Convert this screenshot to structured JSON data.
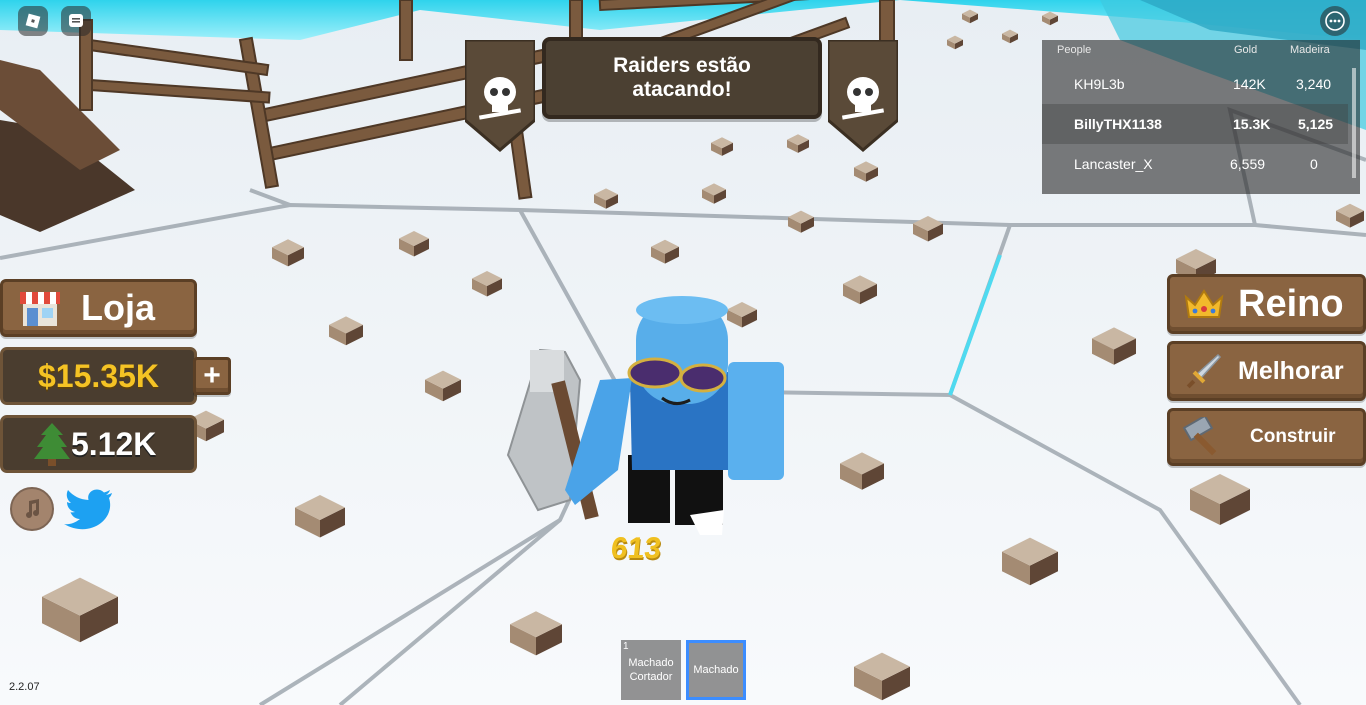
{
  "banner": {
    "line1": "Raiders estão",
    "line2": "atacando!"
  },
  "leaderboard": {
    "headers": {
      "people": "People",
      "gold": "Gold",
      "wood": "Madeira"
    },
    "rows": [
      {
        "name": "KH9L3b",
        "gold": "142K",
        "wood": "3,240"
      },
      {
        "name": "BillyTHX1138",
        "gold": "15.3K",
        "wood": "5,125"
      },
      {
        "name": "Lancaster_X",
        "gold": "6,559",
        "wood": "0"
      }
    ]
  },
  "left_panel": {
    "shop_label": "Loja",
    "money": "$15.35K",
    "plus": "+",
    "wood": "5.12K"
  },
  "right_panel": {
    "kingdom_label": "Reino",
    "upgrade_label": "Melhorar",
    "build_label": "Construir"
  },
  "damage_number": "613",
  "hotbar": [
    {
      "key": "1",
      "label": "Machado Cortador"
    },
    {
      "key": "",
      "label": "Machado"
    }
  ],
  "version": "2.2.07",
  "colors": {
    "snow": "#f1f5f9",
    "wood_button": "#8a6441",
    "banner_bg": "#4b4032",
    "money_gold": "#f5c324",
    "damage_gold": "#f0c020",
    "hotbar_selected": "#3c8dff"
  },
  "icons": [
    "roblox-menu-icon",
    "chat-icon",
    "more-options-icon",
    "skull-icon",
    "shop-icon",
    "pine-tree-icon",
    "music-icon",
    "twitter-bird-icon",
    "crown-icon",
    "sword-icon",
    "hammer-icon"
  ]
}
